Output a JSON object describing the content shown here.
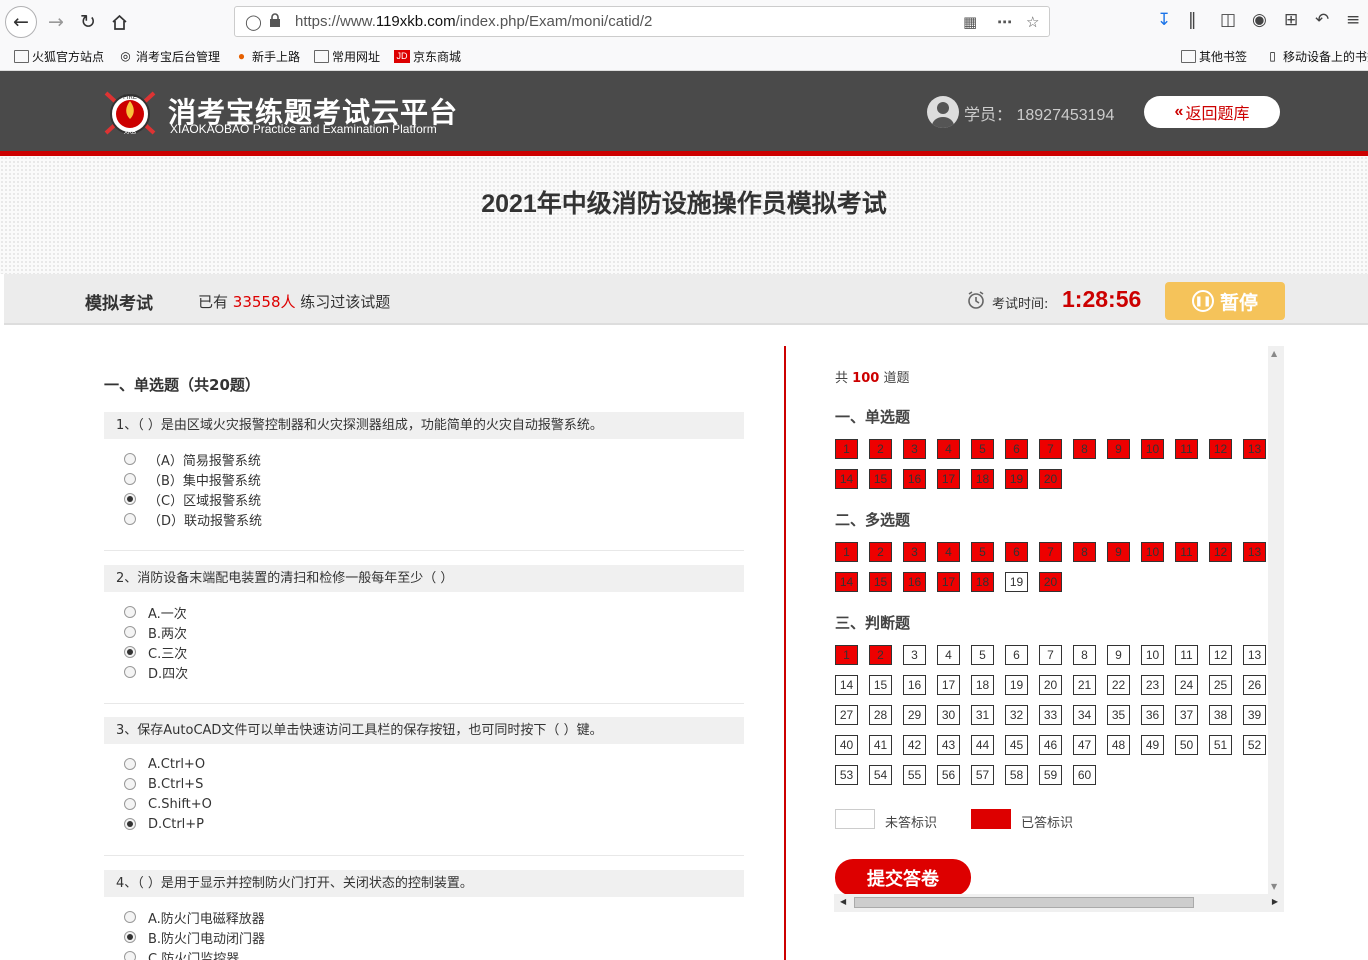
{
  "browser": {
    "url_prefix": "https://www.",
    "url_domain": "119xkb.com",
    "url_path": "/index.php/Exam/moni/catid/2",
    "bookmarks": [
      "火狐官方站点",
      "消考宝后台管理",
      "新手上路",
      "常用网址",
      "京东商城"
    ],
    "other_bookmarks": "其他书签",
    "mobile_bookmarks": "移动设备上的书签"
  },
  "header": {
    "brand_cn": "消考宝练题考试云平台",
    "brand_en": "XIAOKAOBAO Practice and Examination Platform",
    "logo_top": "FIRE",
    "logo_bottom": "XKB",
    "student_label": "学员：",
    "student_id": "18927453194",
    "back_button": "返回题库"
  },
  "exam": {
    "title": "2021年中级消防设施操作员模拟考试",
    "mode": "模拟考试",
    "practice_prefix": "已有",
    "practice_count": "33558人",
    "practice_suffix": "练习过该试题",
    "time_label": "考试时间:",
    "time_value": "1:28:56",
    "pause_label": "暂停"
  },
  "questions": {
    "section_title": "一、单选题（共20题）",
    "items": [
      {
        "text": "1、（ ）是由区域火灾报警控制器和火灾探测器组成，功能简单的火灾自动报警系统。",
        "options": [
          "（A）简易报警系统",
          "（B）集中报警系统",
          "（C）区域报警系统",
          "（D）联动报警系统"
        ],
        "selected": 2
      },
      {
        "text": "2、消防设备末端配电装置的清扫和检修一般每年至少（ ）",
        "options": [
          "A.一次",
          "B.两次",
          "C.三次",
          "D.四次"
        ],
        "selected": 2
      },
      {
        "text": "3、保存AutoCAD文件可以单击快速访问工具栏的保存按钮，也可同时按下（ ）键。",
        "options": [
          "A.Ctrl+O",
          "B.Ctrl+S",
          "C.Shift+O",
          "D.Ctrl+P"
        ],
        "selected": 3
      },
      {
        "text": "4、（ ）是用于显示并控制防火门打开、关闭状态的控制装置。",
        "options": [
          "A.防火门电磁释放器",
          "B.防火门电动闭门器",
          "C.防火门监控器"
        ],
        "selected": 1
      }
    ]
  },
  "answer_card": {
    "total_prefix": "共",
    "total_count": "100",
    "total_suffix": "道题",
    "sections": [
      {
        "label": "一、单选题",
        "count": 20,
        "answered": [
          1,
          2,
          3,
          4,
          5,
          6,
          7,
          8,
          9,
          10,
          11,
          12,
          13,
          14,
          15,
          16,
          17,
          18,
          19,
          20
        ]
      },
      {
        "label": "二、多选题",
        "count": 20,
        "answered": [
          1,
          2,
          3,
          4,
          5,
          6,
          7,
          8,
          9,
          10,
          11,
          12,
          13,
          14,
          15,
          16,
          17,
          18,
          20
        ]
      },
      {
        "label": "三、判断题",
        "count": 60,
        "answered": [
          1,
          2
        ]
      }
    ],
    "legend_unanswered": "未答标识",
    "legend_answered": "已答标识",
    "submit_label": "提交答卷",
    "colors": {
      "answered": "#ee0000",
      "accent": "#cc0000"
    }
  }
}
